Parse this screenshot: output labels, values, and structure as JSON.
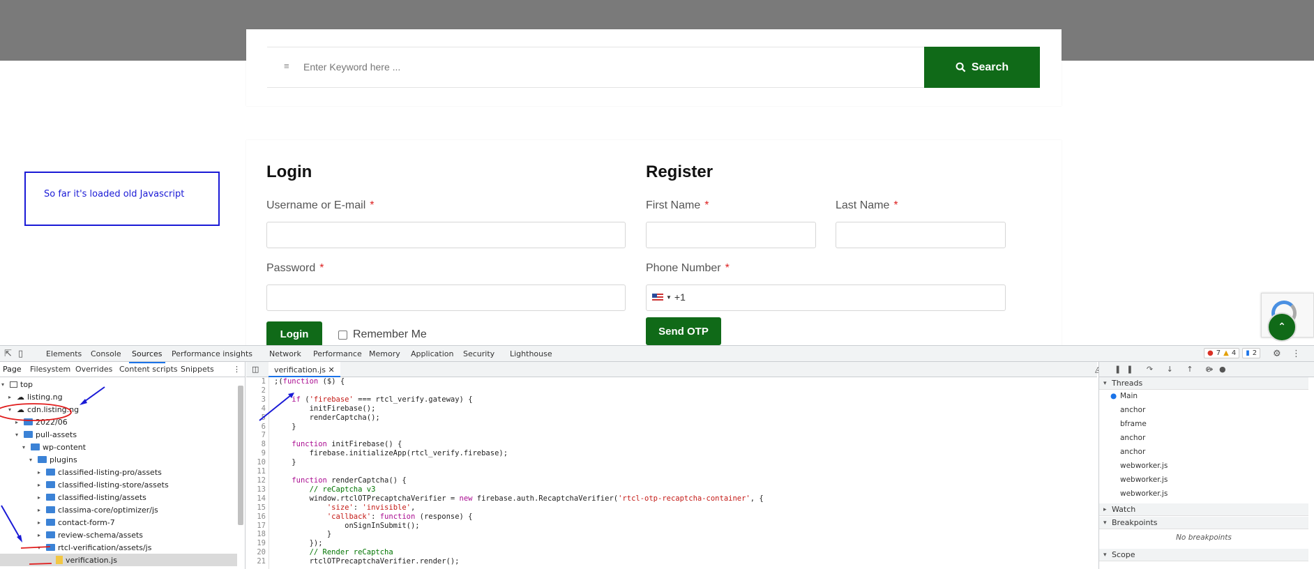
{
  "search": {
    "placeholder": "Enter Keyword here ...",
    "button_label": "Search"
  },
  "login": {
    "title": "Login",
    "username_label": "Username or E-mail",
    "password_label": "Password",
    "required_mark": "*",
    "button_label": "Login",
    "remember_label": "Remember Me"
  },
  "register": {
    "title": "Register",
    "first_name_label": "First Name",
    "last_name_label": "Last Name",
    "phone_label": "Phone Number",
    "phone_code": "+1",
    "send_otp_label": "Send OTP"
  },
  "annotation": {
    "note": "So far it's loaded old Javascript"
  },
  "devtools": {
    "tabs": [
      "Elements",
      "Console",
      "Sources",
      "Performance insights",
      "Network",
      "Performance",
      "Memory",
      "Application",
      "Security",
      "Lighthouse"
    ],
    "active_tab": "Sources",
    "errors": "7",
    "warnings": "4",
    "messages": "2",
    "nav_tabs": [
      "Page",
      "Filesystem",
      "Overrides",
      "Content scripts",
      "Snippets"
    ],
    "tree": [
      "top",
      "listing.ng",
      "cdn.listing.ng",
      "2022/06",
      "pull-assets",
      "wp-content",
      "plugins",
      "classified-listing-pro/assets",
      "classified-listing-store/assets",
      "classified-listing/assets",
      "classima-core/optimizer/js",
      "contact-form-7",
      "review-schema/assets",
      "rtcl-verification/assets/js",
      "verification.js"
    ],
    "editor_tab": "verification.js",
    "line_numbers": [
      "1",
      "2",
      "3",
      "4",
      "5",
      "6",
      "7",
      "8",
      "9",
      "10",
      "11",
      "12",
      "13",
      "14",
      "15",
      "16",
      "17",
      "18",
      "19",
      "20",
      "21"
    ],
    "code": [
      ";(function ($) {",
      "",
      "    if ('firebase' === rtcl_verify.gateway) {",
      "        initFirebase();",
      "        renderCaptcha();",
      "    }",
      "",
      "    function initFirebase() {",
      "        firebase.initializeApp(rtcl_verify.firebase);",
      "    }",
      "",
      "    function renderCaptcha() {",
      "        // reCaptcha v3",
      "        window.rtclOTPrecaptchaVerifier = new firebase.auth.RecaptchaVerifier('rtcl-otp-recaptcha-container', {",
      "            'size': 'invisible',",
      "            'callback': function (response) {",
      "                onSignInSubmit();",
      "            }",
      "        });",
      "        // Render reCaptcha",
      "        rtclOTPrecaptchaVerifier.render();"
    ],
    "debugger": {
      "threads_label": "Threads",
      "threads": [
        "Main",
        "anchor",
        "bframe",
        "anchor",
        "anchor",
        "webworker.js",
        "webworker.js",
        "webworker.js"
      ],
      "watch_label": "Watch",
      "breakpoints_label": "Breakpoints",
      "no_breakpoints": "No breakpoints",
      "scope_label": "Scope"
    }
  },
  "colors": {
    "accent_green": "#106a18",
    "annotation_blue": "#1a1ad6",
    "annotation_red": "#e01b1b"
  }
}
